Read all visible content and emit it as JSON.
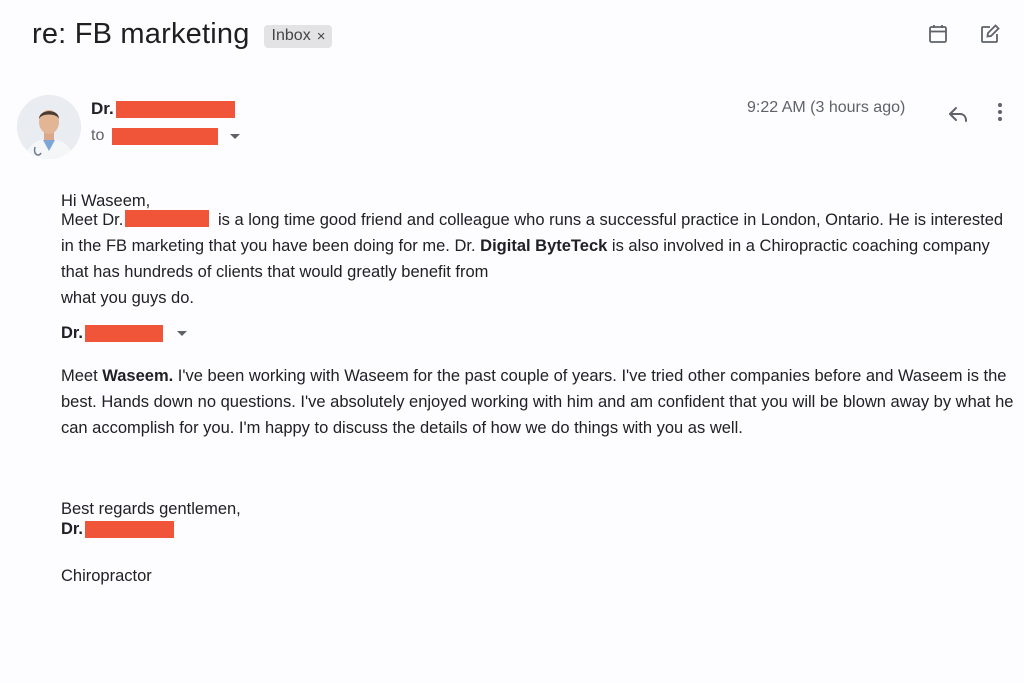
{
  "header": {
    "subject": "re: FB marketing",
    "label": "Inbox",
    "label_remove": "×"
  },
  "sender": {
    "prefix": "Dr.",
    "to_label": "to",
    "timestamp": "9:22 AM (3 hours ago)"
  },
  "body": {
    "greeting": "Hi Waseem,",
    "para1_a": "Meet Dr.",
    "para1_b": " is a long time good friend and colleague who runs a successful practice in London, Ontario. He is interested in the FB marketing that you have been doing for me. Dr. ",
    "para1_bold": "Digital ByteTeck",
    "para1_c": " is also involved in a Chiropractic coaching company that has hundreds of clients that would greatly benefit from",
    "para1_d": "what you guys do.",
    "dr_mid": "Dr.",
    "para2_a": "Meet ",
    "para2_bold": "Waseem.",
    "para2_b": " I've been working with Waseem for the past couple of years. I've tried other companies before and Waseem is the best. Hands down no questions. I've absolutely enjoyed working with him and am confident that you will be blown away by what he can accomplish for you. I'm happy to discuss the details of how we do things with you as well.",
    "closing": "Best regards gentlemen,",
    "sig_name": "Dr.",
    "sig_title": "Chiropractor"
  },
  "icons": {
    "calendar": "calendar-icon",
    "edit": "edit-icon",
    "reply": "reply-icon",
    "more": "more-vert-icon",
    "caret": "chevron-down-icon"
  },
  "colors": {
    "redaction": "#f0553a",
    "chip_bg": "#e3e3e6",
    "meta_text": "#5f6368"
  }
}
